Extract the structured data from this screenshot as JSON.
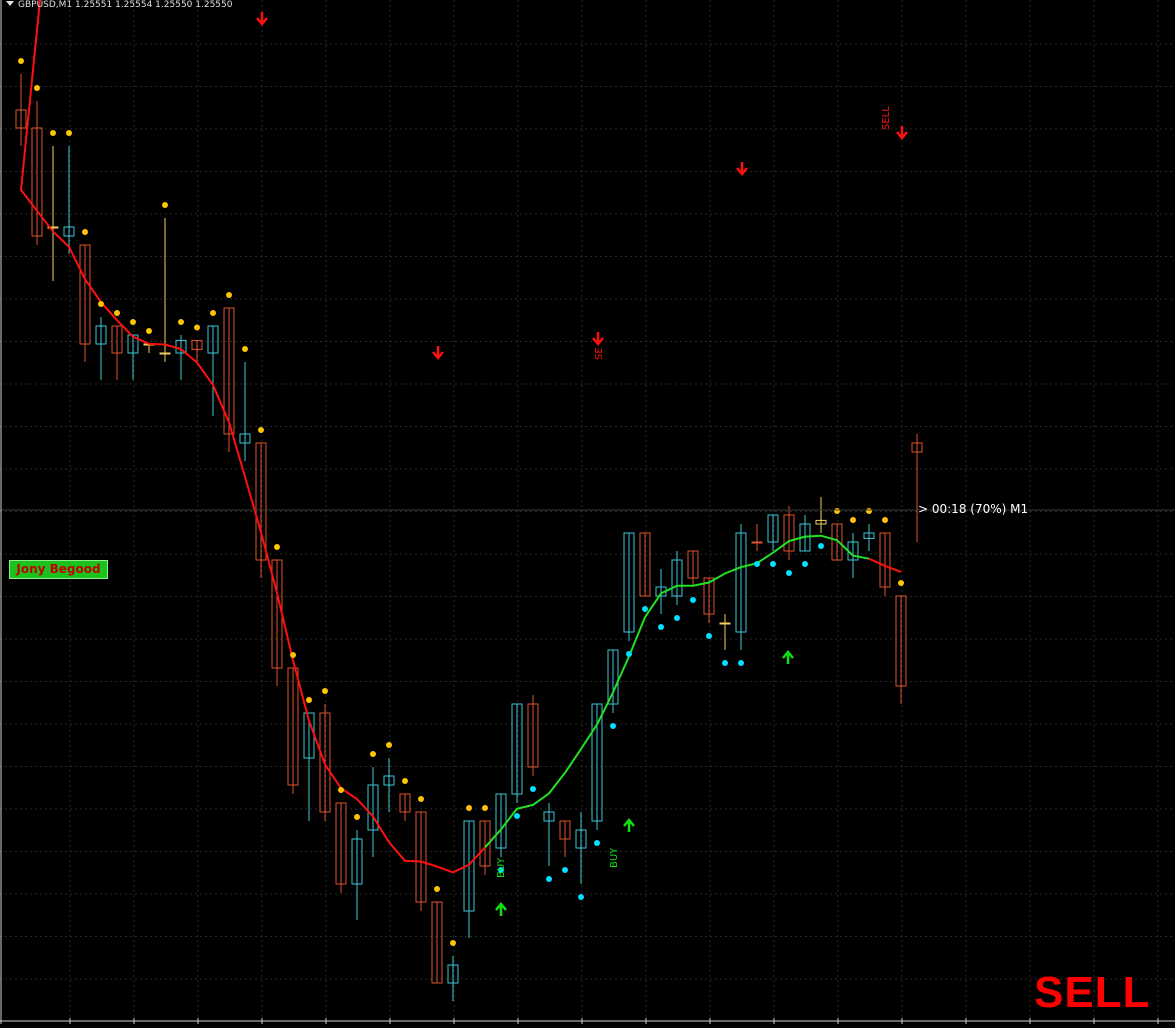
{
  "header": {
    "symbol_info": "GBPUSD,M1  1.25551 1.25554 1.25550 1.25550"
  },
  "brand_label": "Jony Begood",
  "timer": "> 00:18 (70%) M1",
  "signal_banner": "SELL",
  "colors": {
    "background": "#000000",
    "grid": "#2a2a2a",
    "bull": "#3cc8d8",
    "bear": "#e0522c",
    "doji": "#f0d060",
    "ma_down": "#ff1010",
    "ma_up": "#22e022",
    "dot_yellow": "#ffc400",
    "dot_cyan": "#00e0ff",
    "arrow_sell": "#ff1010",
    "arrow_buy": "#10e010"
  },
  "chart_data": {
    "type": "candlestick",
    "symbol": "GBPUSD",
    "timeframe": "M1",
    "candles": [
      {
        "o": 1.2574,
        "h": 1.2576,
        "l": 1.2572,
        "c": 1.2573,
        "t": "bear"
      },
      {
        "o": 1.2573,
        "h": 1.25745,
        "l": 1.25665,
        "c": 1.2567,
        "t": "bear"
      },
      {
        "o": 1.25675,
        "h": 1.2572,
        "l": 1.25645,
        "c": 1.25675,
        "t": "doji"
      },
      {
        "o": 1.2567,
        "h": 1.2572,
        "l": 1.2566,
        "c": 1.25675,
        "t": "bull"
      },
      {
        "o": 1.25665,
        "h": 1.25665,
        "l": 1.256,
        "c": 1.2561,
        "t": "bear"
      },
      {
        "o": 1.2561,
        "h": 1.25625,
        "l": 1.2559,
        "c": 1.2562,
        "t": "bull"
      },
      {
        "o": 1.2562,
        "h": 1.2562,
        "l": 1.2559,
        "c": 1.25605,
        "t": "bear"
      },
      {
        "o": 1.25605,
        "h": 1.25615,
        "l": 1.2559,
        "c": 1.25615,
        "t": "bull"
      },
      {
        "o": 1.2561,
        "h": 1.2561,
        "l": 1.25605,
        "c": 1.2561,
        "t": "doji"
      },
      {
        "o": 1.25605,
        "h": 1.2568,
        "l": 1.256,
        "c": 1.25605,
        "t": "doji"
      },
      {
        "o": 1.25605,
        "h": 1.25615,
        "l": 1.2559,
        "c": 1.25612,
        "t": "bull"
      },
      {
        "o": 1.25612,
        "h": 1.25612,
        "l": 1.256,
        "c": 1.25607,
        "t": "bear"
      },
      {
        "o": 1.25605,
        "h": 1.2562,
        "l": 1.2557,
        "c": 1.2562,
        "t": "bull"
      },
      {
        "o": 1.2563,
        "h": 1.2563,
        "l": 1.2555,
        "c": 1.2556,
        "t": "bear"
      },
      {
        "o": 1.25555,
        "h": 1.256,
        "l": 1.25545,
        "c": 1.2556,
        "t": "bull"
      },
      {
        "o": 1.25555,
        "h": 1.25555,
        "l": 1.2548,
        "c": 1.2549,
        "t": "bear"
      },
      {
        "o": 1.2549,
        "h": 1.2549,
        "l": 1.2542,
        "c": 1.2543,
        "t": "bear"
      },
      {
        "o": 1.2543,
        "h": 1.2543,
        "l": 1.2536,
        "c": 1.25365,
        "t": "bear"
      },
      {
        "o": 1.2538,
        "h": 1.254,
        "l": 1.25345,
        "c": 1.25405,
        "t": "bull"
      },
      {
        "o": 1.25405,
        "h": 1.2541,
        "l": 1.25345,
        "c": 1.2535,
        "t": "bear"
      },
      {
        "o": 1.25355,
        "h": 1.25355,
        "l": 1.25305,
        "c": 1.2531,
        "t": "bear"
      },
      {
        "o": 1.2531,
        "h": 1.2534,
        "l": 1.2529,
        "c": 1.25335,
        "t": "bull"
      },
      {
        "o": 1.2534,
        "h": 1.25375,
        "l": 1.25325,
        "c": 1.25365,
        "t": "bull"
      },
      {
        "o": 1.25365,
        "h": 1.2538,
        "l": 1.2535,
        "c": 1.2537,
        "t": "bull"
      },
      {
        "o": 1.2536,
        "h": 1.2536,
        "l": 1.25345,
        "c": 1.2535,
        "t": "bear"
      },
      {
        "o": 1.2535,
        "h": 1.2535,
        "l": 1.25295,
        "c": 1.253,
        "t": "bear"
      },
      {
        "o": 1.253,
        "h": 1.253,
        "l": 1.25255,
        "c": 1.25255,
        "t": "bear"
      },
      {
        "o": 1.25255,
        "h": 1.2527,
        "l": 1.25245,
        "c": 1.25265,
        "t": "bull"
      },
      {
        "o": 1.25295,
        "h": 1.25345,
        "l": 1.2528,
        "c": 1.25345,
        "t": "bull"
      },
      {
        "o": 1.25345,
        "h": 1.25345,
        "l": 1.25315,
        "c": 1.2532,
        "t": "bear"
      },
      {
        "o": 1.2533,
        "h": 1.2536,
        "l": 1.25325,
        "c": 1.2536,
        "t": "bull"
      },
      {
        "o": 1.2536,
        "h": 1.2541,
        "l": 1.25355,
        "c": 1.2541,
        "t": "bull"
      },
      {
        "o": 1.2541,
        "h": 1.25415,
        "l": 1.2537,
        "c": 1.25375,
        "t": "bear"
      },
      {
        "o": 1.25345,
        "h": 1.25355,
        "l": 1.2532,
        "c": 1.2535,
        "t": "bull"
      },
      {
        "o": 1.25345,
        "h": 1.25345,
        "l": 1.25325,
        "c": 1.25335,
        "t": "bear"
      },
      {
        "o": 1.2533,
        "h": 1.2535,
        "l": 1.2531,
        "c": 1.2534,
        "t": "bull"
      },
      {
        "o": 1.25345,
        "h": 1.2541,
        "l": 1.2534,
        "c": 1.2541,
        "t": "bull"
      },
      {
        "o": 1.2541,
        "h": 1.2544,
        "l": 1.25405,
        "c": 1.2544,
        "t": "bull"
      },
      {
        "o": 1.2545,
        "h": 1.25505,
        "l": 1.25445,
        "c": 1.25505,
        "t": "bull"
      },
      {
        "o": 1.25505,
        "h": 1.25505,
        "l": 1.2547,
        "c": 1.2547,
        "t": "bear"
      },
      {
        "o": 1.2547,
        "h": 1.25485,
        "l": 1.2546,
        "c": 1.25475,
        "t": "bull"
      },
      {
        "o": 1.2547,
        "h": 1.25495,
        "l": 1.25465,
        "c": 1.2549,
        "t": "bull"
      },
      {
        "o": 1.25495,
        "h": 1.25495,
        "l": 1.25475,
        "c": 1.2548,
        "t": "bear"
      },
      {
        "o": 1.2548,
        "h": 1.2548,
        "l": 1.25455,
        "c": 1.2546,
        "t": "bear"
      },
      {
        "o": 1.25455,
        "h": 1.2546,
        "l": 1.2544,
        "c": 1.25455,
        "t": "doji"
      },
      {
        "o": 1.2545,
        "h": 1.2551,
        "l": 1.2544,
        "c": 1.25505,
        "t": "bull"
      },
      {
        "o": 1.255,
        "h": 1.2551,
        "l": 1.25495,
        "c": 1.255,
        "t": "bear"
      },
      {
        "o": 1.255,
        "h": 1.25515,
        "l": 1.25495,
        "c": 1.25515,
        "t": "bull"
      },
      {
        "o": 1.25515,
        "h": 1.2552,
        "l": 1.2549,
        "c": 1.25495,
        "t": "bear"
      },
      {
        "o": 1.25495,
        "h": 1.25515,
        "l": 1.25495,
        "c": 1.2551,
        "t": "bull"
      },
      {
        "o": 1.2551,
        "h": 1.25525,
        "l": 1.25505,
        "c": 1.25512,
        "t": "doji"
      },
      {
        "o": 1.2551,
        "h": 1.2551,
        "l": 1.2549,
        "c": 1.2549,
        "t": "bear"
      },
      {
        "o": 1.2549,
        "h": 1.25505,
        "l": 1.2548,
        "c": 1.255,
        "t": "bull"
      },
      {
        "o": 1.25502,
        "h": 1.2551,
        "l": 1.25495,
        "c": 1.25505,
        "t": "bull"
      },
      {
        "o": 1.25505,
        "h": 1.25505,
        "l": 1.2547,
        "c": 1.25475,
        "t": "bear"
      },
      {
        "o": 1.2547,
        "h": 1.2547,
        "l": 1.2541,
        "c": 1.2542,
        "t": "bear"
      },
      {
        "o": 1.25555,
        "h": 1.2556,
        "l": 1.255,
        "c": 1.2555,
        "t": "bear"
      }
    ],
    "indicator_line_color_flip_index": 30,
    "signals": [
      {
        "type": "sell",
        "label": ""
      },
      {
        "type": "sell",
        "label": ""
      },
      {
        "type": "sell",
        "label": "SE"
      },
      {
        "type": "sell",
        "label": ""
      },
      {
        "type": "sell",
        "label": "SELL"
      },
      {
        "type": "buy",
        "label": "BUY"
      },
      {
        "type": "buy",
        "label": "BUY"
      },
      {
        "type": "buy",
        "label": ""
      }
    ],
    "ylim": [
      1.2524,
      1.2579
    ],
    "grid": true
  }
}
